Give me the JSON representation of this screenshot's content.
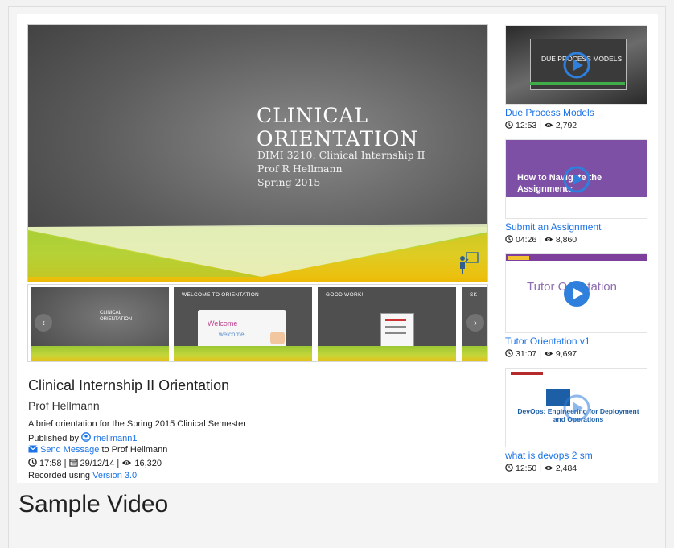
{
  "player": {
    "slide_title": "CLINICAL ORIENTATION",
    "slide_lines": [
      "DIMI 3210: Clinical Internship II",
      "Prof R Hellmann",
      "Spring 2015"
    ]
  },
  "thumbnails": [
    {
      "heading": "CLINICAL ORIENTATION"
    },
    {
      "heading": "WELCOME TO ORIENTATION"
    },
    {
      "heading": "GOOD WORK!"
    },
    {
      "heading": "SK"
    }
  ],
  "video": {
    "title": "Clinical Internship II Orientation",
    "author": "Prof Hellmann",
    "description": "A brief orientation for the Spring 2015 Clinical Semester",
    "published_prefix": "Published by",
    "publisher": "rhellmann1",
    "send_message": "Send Message",
    "send_suffix": "to Prof Hellmann",
    "duration": "17:58",
    "date": "29/12/14",
    "views": "16,320",
    "recorded_prefix": "Recorded using",
    "version": "Version 3.0"
  },
  "sidebar": [
    {
      "thumb_text": "DUE PROCESS MODELS",
      "title": "Due Process Models",
      "duration": "12:53",
      "views": "2,792"
    },
    {
      "thumb_text": "How to Navigate the Assignments",
      "title": "Submit an Assignment",
      "duration": "04:26",
      "views": "8,860"
    },
    {
      "thumb_text": "Tutor Orientation",
      "title": "Tutor Orientation v1",
      "duration": "31:07",
      "views": "9,697"
    },
    {
      "thumb_text": "DevOps: Engineering for Deployment and Operations",
      "title": "what is devops 2 sm",
      "duration": "12:50",
      "views": "2,484"
    }
  ],
  "footer": {
    "label": "Sample Video"
  },
  "colors": {
    "link": "#1a73e8",
    "play": "#2f7fdc"
  }
}
